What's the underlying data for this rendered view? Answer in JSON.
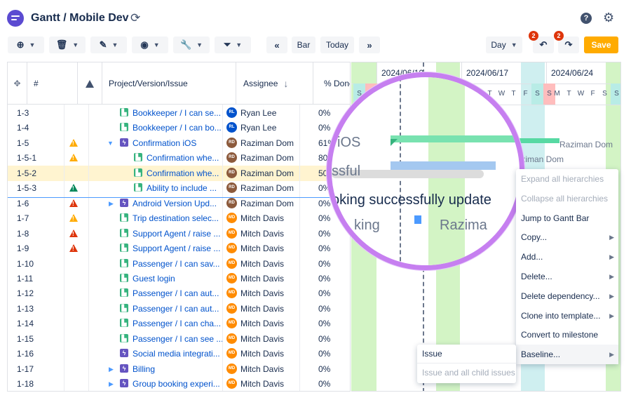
{
  "header": {
    "title": "Gantt / Mobile Dev"
  },
  "toolbar": {
    "nav_first": "«",
    "bar_label": "Bar",
    "today_label": "Today",
    "nav_last": "»",
    "day_label": "Day",
    "undo_count": "2",
    "redo_count": "2",
    "save_label": "Save"
  },
  "grid": {
    "columns": {
      "id": "#",
      "project": "Project/Version/Issue",
      "assignee": "Assignee",
      "sort_arrow": "↓",
      "done": "% Done"
    },
    "rows": [
      {
        "id": "1-3",
        "warn": "",
        "title": "Bookkeeper / I can se...",
        "type": "story",
        "assignee": "Ryan Lee",
        "avatar": "RL",
        "done": "0%"
      },
      {
        "id": "1-4",
        "warn": "",
        "title": "Bookkeeper / I can bo...",
        "type": "story",
        "assignee": "Ryan Lee",
        "avatar": "RL",
        "done": "0%"
      },
      {
        "id": "1-5",
        "warn": "orange",
        "title": "Confirmation iOS",
        "type": "epic",
        "assignee": "Raziman Dom",
        "avatar": "RD",
        "done": "61%"
      },
      {
        "id": "1-5-1",
        "warn": "orange",
        "title": "Confirmation whe...",
        "type": "story",
        "assignee": "Raziman Dom",
        "avatar": "RD",
        "done": "80%"
      },
      {
        "id": "1-5-2",
        "warn": "",
        "title": "Confirmation whe...",
        "type": "story",
        "assignee": "Raziman Dom",
        "avatar": "RD",
        "done": "50%"
      },
      {
        "id": "1-5-3",
        "warn": "green",
        "title": "Ability to include ...",
        "type": "story",
        "assignee": "Raziman Dom",
        "avatar": "RD",
        "done": "0%"
      },
      {
        "id": "1-6",
        "warn": "red",
        "title": "Android Version Upd...",
        "type": "epic",
        "assignee": "Raziman Dom",
        "avatar": "RD",
        "done": "0%"
      },
      {
        "id": "1-7",
        "warn": "orange",
        "title": "Trip destination selec...",
        "type": "story",
        "assignee": "Mitch Davis",
        "avatar": "MD",
        "done": "0%"
      },
      {
        "id": "1-8",
        "warn": "red",
        "title": "Support Agent / raise ...",
        "type": "story",
        "assignee": "Mitch Davis",
        "avatar": "MD",
        "done": "0%"
      },
      {
        "id": "1-9",
        "warn": "red",
        "title": "Support Agent / raise ...",
        "type": "story",
        "assignee": "Mitch Davis",
        "avatar": "MD",
        "done": "0%"
      },
      {
        "id": "1-10",
        "warn": "",
        "title": "Passenger / I can sav...",
        "type": "story",
        "assignee": "Mitch Davis",
        "avatar": "MD",
        "done": "0%"
      },
      {
        "id": "1-11",
        "warn": "",
        "title": "Guest login",
        "type": "story",
        "assignee": "Mitch Davis",
        "avatar": "MD",
        "done": "0%"
      },
      {
        "id": "1-12",
        "warn": "",
        "title": "Passenger / I can aut...",
        "type": "story",
        "assignee": "Mitch Davis",
        "avatar": "MD",
        "done": "0%"
      },
      {
        "id": "1-13",
        "warn": "",
        "title": "Passenger / I can aut...",
        "type": "story",
        "assignee": "Mitch Davis",
        "avatar": "MD",
        "done": "0%"
      },
      {
        "id": "1-14",
        "warn": "",
        "title": "Passenger / I can cha...",
        "type": "story",
        "assignee": "Mitch Davis",
        "avatar": "MD",
        "done": "0%"
      },
      {
        "id": "1-15",
        "warn": "",
        "title": "Passenger / I can see ...",
        "type": "story",
        "assignee": "Mitch Davis",
        "avatar": "MD",
        "done": "0%"
      },
      {
        "id": "1-16",
        "warn": "",
        "title": "Social media integrati...",
        "type": "epic",
        "assignee": "Mitch Davis",
        "avatar": "MD",
        "done": "0%"
      },
      {
        "id": "1-17",
        "warn": "",
        "title": "Billing",
        "type": "epic",
        "assignee": "Mitch Davis",
        "avatar": "MD",
        "done": "0%"
      },
      {
        "id": "1-18",
        "warn": "",
        "title": "Group booking experi...",
        "type": "epic",
        "assignee": "Mitch Davis",
        "avatar": "MD",
        "done": "0%"
      }
    ]
  },
  "gantt": {
    "weeks": [
      "2024/06/10",
      "2024/06/17",
      "2024/06/24"
    ],
    "days": [
      "S",
      "S",
      "M",
      "T",
      "W",
      "T",
      "F",
      "S",
      "S",
      "M",
      "T",
      "W",
      "F",
      "S",
      "S"
    ],
    "bar_label_1": "Raziman Dom",
    "bar_label_2": "Raziman Dom"
  },
  "magnifier": {
    "t1": "iOS",
    "t2": "ssful",
    "t3": "oking successfully update",
    "t4": "king",
    "t5": "Razima"
  },
  "context_menu": [
    {
      "label": "Expand all hierarchies",
      "disabled": true,
      "arrow": ""
    },
    {
      "label": "Collapse all hierarchies",
      "disabled": true,
      "arrow": ""
    },
    {
      "label": "Jump to Gantt Bar",
      "disabled": false,
      "arrow": ""
    },
    {
      "label": "Copy...",
      "disabled": false,
      "arrow": "▶"
    },
    {
      "label": "Add...",
      "disabled": false,
      "arrow": "▶"
    },
    {
      "label": "Delete...",
      "disabled": false,
      "arrow": "▶"
    },
    {
      "label": "Delete dependency...",
      "disabled": false,
      "arrow": "▶"
    },
    {
      "label": "Clone into template...",
      "disabled": false,
      "arrow": "▶"
    },
    {
      "label": "Convert to milestone",
      "disabled": false,
      "arrow": ""
    },
    {
      "label": "Baseline...",
      "disabled": false,
      "arrow": "▶"
    }
  ],
  "submenu": [
    {
      "label": "Issue",
      "disabled": false
    },
    {
      "label": "Issue and all child issues",
      "disabled": true
    }
  ],
  "colors": {
    "accent": "#0052cc",
    "story": "#36b37e",
    "epic": "#6554c0",
    "warn_orange": "#ffab00",
    "warn_red": "#de350b",
    "warn_green": "#00875a",
    "save": "#ffab00",
    "weekend": "#d3f4c5",
    "magnifier": "#c67ff0"
  }
}
